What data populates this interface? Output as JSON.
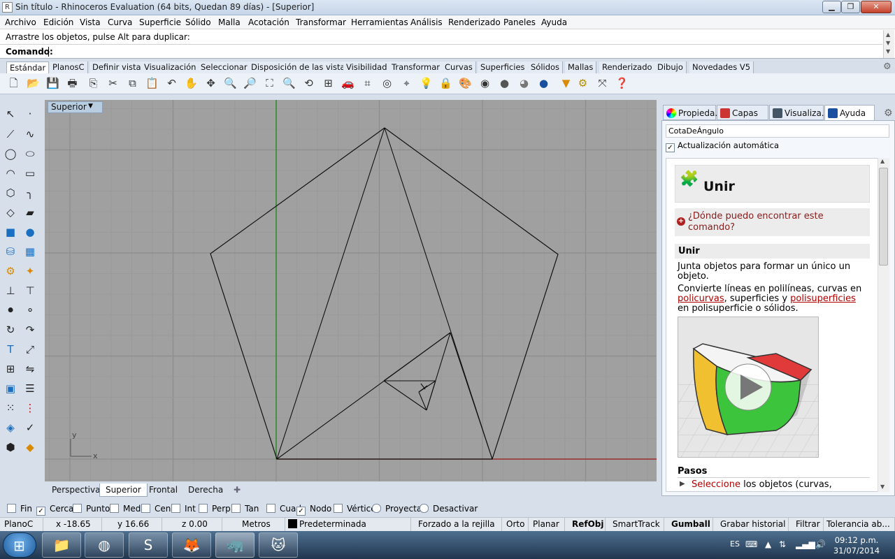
{
  "window": {
    "title": "Sin título - Rhinoceros Evaluation (64 bits, Quedan 89 días) - [Superior]"
  },
  "menu": [
    "Archivo",
    "Edición",
    "Vista",
    "Curva",
    "Superficie",
    "Sólido",
    "Malla",
    "Acotación",
    "Transformar",
    "Herramientas",
    "Análisis",
    "Renderizado",
    "Paneles",
    "Ayuda"
  ],
  "command": {
    "prompt_text": "Arrastre los objetos, pulse Alt para duplicar:",
    "label": "Comando:",
    "value": ""
  },
  "toolbar_tabs": [
    "Estándar",
    "PlanosC",
    "Definir vista",
    "Visualización",
    "Seleccionar",
    "Disposición de las vistas",
    "Visibilidad",
    "Transformar",
    "Curvas",
    "Superficies",
    "Sólidos",
    "Mallas",
    "Renderizado",
    "Dibujo",
    "Novedades V5"
  ],
  "toolbar_icons": [
    "new-file-icon",
    "open-folder-icon",
    "save-icon",
    "print-icon",
    "import-icon",
    "cut-icon",
    "copy-icon",
    "paste-icon",
    "undo-icon",
    "pan-hand-icon",
    "move-view-icon",
    "zoom-icon",
    "zoom-window-icon",
    "zoom-extents-icon",
    "zoom-selected-icon",
    "rotate-view-icon",
    "four-viewports-icon",
    "car-icon",
    "grid-options-icon",
    "cplane-icon",
    "snap-icon",
    "bulb-icon",
    "lock-icon",
    "paint-icon",
    "color-wheel-icon",
    "shaded-sphere-icon",
    "render-sphere-icon",
    "blue-sphere-icon",
    "light-icon",
    "options-gear-icon",
    "join-icon",
    "help-icon"
  ],
  "viewport": {
    "title": "Superior",
    "axis_y": "y",
    "axis_x": "x"
  },
  "viewport_tabs": [
    "Perspectiva",
    "Superior",
    "Frontal",
    "Derecha"
  ],
  "panel_tabs": [
    "Propieda...",
    "Capas",
    "Visualiza...",
    "Ayuda"
  ],
  "help": {
    "field_value": "CotaDeÁngulo",
    "auto_update_label": "Actualización automática",
    "title": "Unir",
    "where_question": "¿Dónde puedo encontrar este comando?",
    "section_title": "Unir",
    "desc1": "Junta objetos para formar un único un objeto.",
    "desc2_a": "Convierte líneas en polilíneas, curvas en ",
    "desc2_link1": "policurvas",
    "desc2_b": ", superficies y ",
    "desc2_link2": "polisuperficies",
    "desc2_c": " en polisuperficie o sólidos.",
    "steps_title": "Pasos",
    "step1_link": "Seleccione",
    "step1_text": " los objetos (curvas,"
  },
  "osnaps": [
    {
      "label": "Fin",
      "checked": false
    },
    {
      "label": "Cerca",
      "checked": true
    },
    {
      "label": "Punto",
      "checked": false
    },
    {
      "label": "Med",
      "checked": false
    },
    {
      "label": "Cen",
      "checked": false
    },
    {
      "label": "Int",
      "checked": false
    },
    {
      "label": "Perp",
      "checked": false
    },
    {
      "label": "Tan",
      "checked": false
    },
    {
      "label": "Cuad",
      "checked": false
    },
    {
      "label": "Nodo",
      "checked": true
    },
    {
      "label": "Vértice",
      "checked": false
    },
    {
      "label": "Proyectar",
      "checked": false
    },
    {
      "label": "Desactivar",
      "checked": false
    }
  ],
  "status": {
    "cplane": "PlanoC",
    "x": "x -18.65",
    "y": "y 16.66",
    "z": "z 0.00",
    "units": "Metros",
    "layer": "Predeterminada",
    "grid_snap": "Forzado a la rejilla",
    "ortho": "Orto",
    "planar": "Planar",
    "osnap": "RefObj",
    "smarttrack": "SmartTrack",
    "gumball": "Gumball",
    "history": "Grabar historial",
    "filter": "Filtrar",
    "tolerance": "Tolerancia ab..."
  },
  "taskbar": {
    "apps": [
      "explorer-icon",
      "chrome-icon",
      "sublime-icon",
      "firefox-icon",
      "rhino-icon",
      "cat-app-icon"
    ],
    "lang": "ES",
    "time": "09:12 p.m.",
    "date": "31/07/2014"
  },
  "colors": {
    "viewport_bg": "#a0a0a0",
    "x_axis": "#9b1b1b",
    "y_axis": "#1a8a1a",
    "link": "#b00000"
  }
}
